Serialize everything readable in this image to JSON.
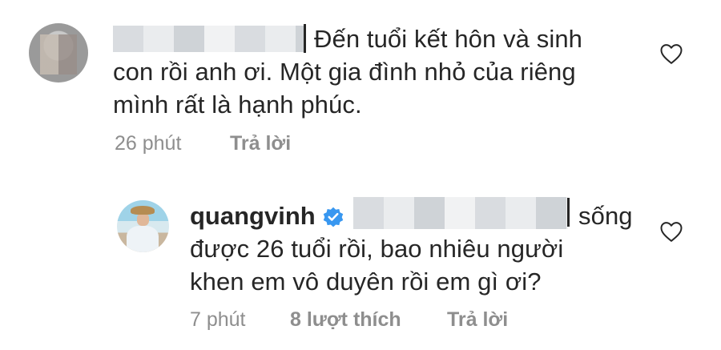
{
  "comment1": {
    "avatar_icon": "user-avatar-blurred",
    "lines": [
      "Đến tuổi kết hôn và sinh",
      "con rồi anh ơi. Một gia đình nhỏ của riêng",
      "mình rất là hạnh phúc."
    ],
    "time": "26 phút",
    "reply_label": "Trả lời"
  },
  "comment2": {
    "username": "quangvinh",
    "verified_icon": "verified-badge-icon",
    "lines": [
      "sống",
      "được 26 tuổi rồi, bao nhiêu người",
      "khen em vô duyên rồi em gì ơi?"
    ],
    "time": "7 phút",
    "likes": "8 lượt thích",
    "reply_label": "Trả lời"
  },
  "colors": {
    "text": "#262626",
    "meta": "#8e8e8e",
    "verified": "#3897f0"
  }
}
